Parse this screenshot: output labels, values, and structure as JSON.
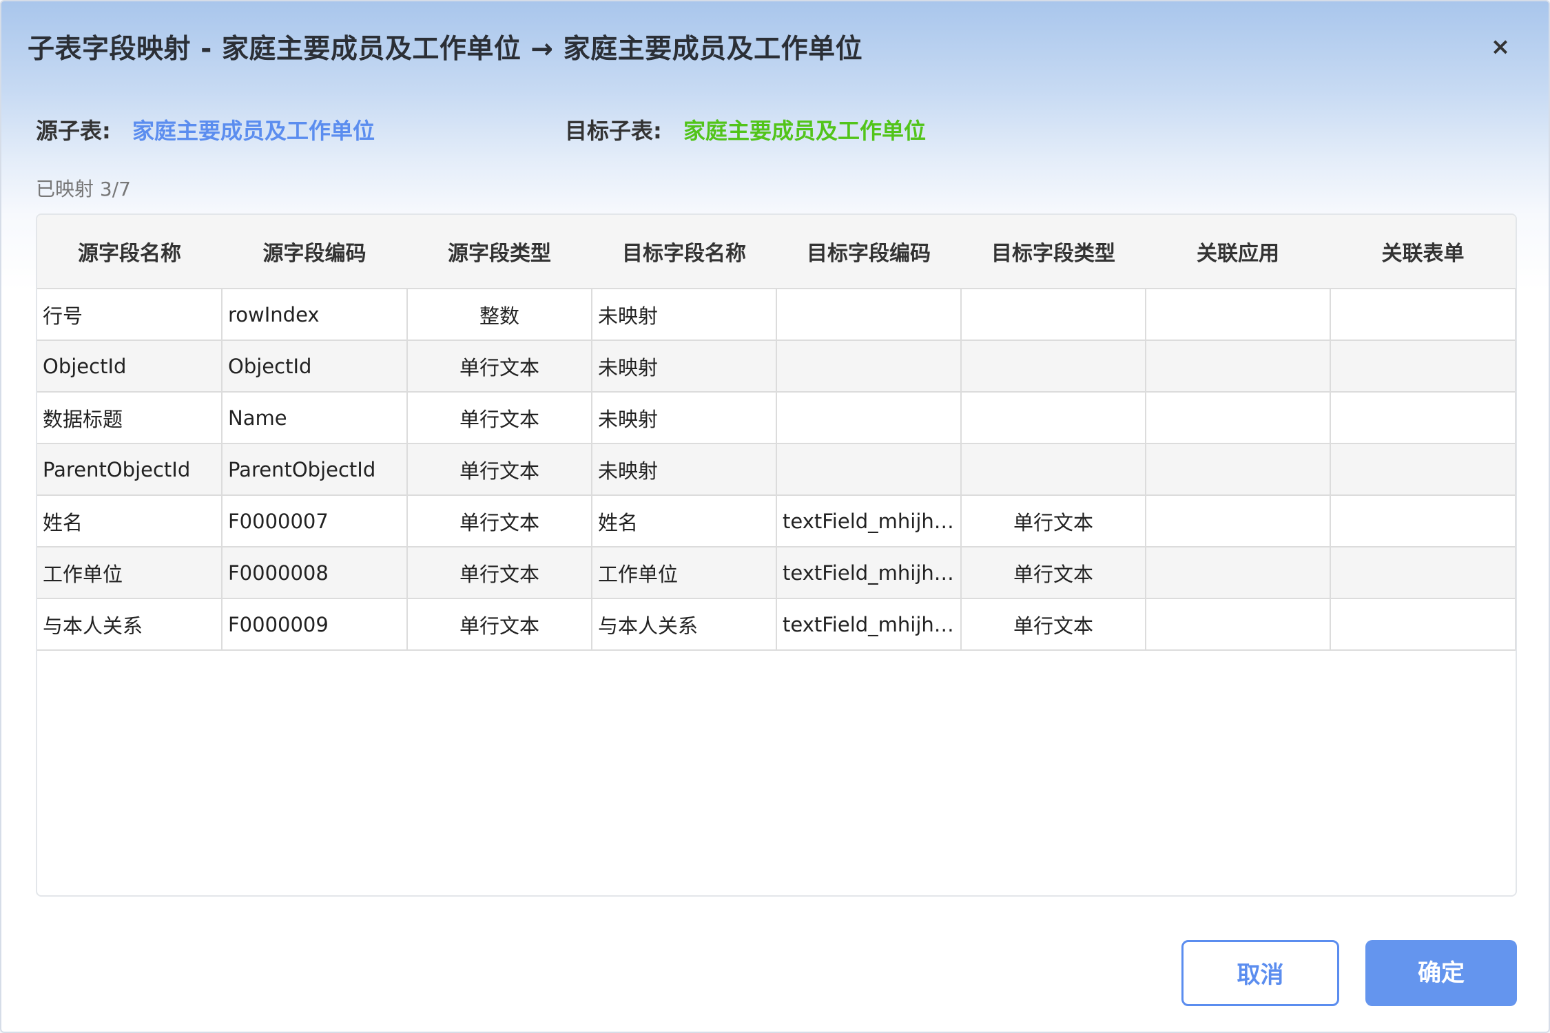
{
  "dialog": {
    "title": "子表字段映射 - 家庭主要成员及工作单位 → 家庭主要成员及工作单位",
    "close_symbol": "×"
  },
  "source": {
    "label": "源子表:",
    "name": "家庭主要成员及工作单位"
  },
  "target": {
    "label": "目标子表:",
    "name": "家庭主要成员及工作单位"
  },
  "mapped_status": "已映射 3/7",
  "table": {
    "headers": [
      "源字段名称",
      "源字段编码",
      "源字段类型",
      "目标字段名称",
      "目标字段编码",
      "目标字段类型",
      "关联应用",
      "关联表单"
    ],
    "rows": [
      [
        "行号",
        "rowIndex",
        "整数",
        "未映射",
        "",
        "",
        "",
        ""
      ],
      [
        "ObjectId",
        "ObjectId",
        "单行文本",
        "未映射",
        "",
        "",
        "",
        ""
      ],
      [
        "数据标题",
        "Name",
        "单行文本",
        "未映射",
        "",
        "",
        "",
        ""
      ],
      [
        "ParentObjectId",
        "ParentObjectId",
        "单行文本",
        "未映射",
        "",
        "",
        "",
        ""
      ],
      [
        "姓名",
        "F0000007",
        "单行文本",
        "姓名",
        "textField_mhijhm...",
        "单行文本",
        "",
        ""
      ],
      [
        "工作单位",
        "F0000008",
        "单行文本",
        "工作单位",
        "textField_mhijhm...",
        "单行文本",
        "",
        ""
      ],
      [
        "与本人关系",
        "F0000009",
        "单行文本",
        "与本人关系",
        "textField_mhijhm...",
        "单行文本",
        "",
        ""
      ]
    ]
  },
  "buttons": {
    "cancel": "取消",
    "confirm": "确定"
  },
  "colors": {
    "source_accent": "#5b8def",
    "target_accent": "#52c41a",
    "primary_button": "#6495ee"
  }
}
